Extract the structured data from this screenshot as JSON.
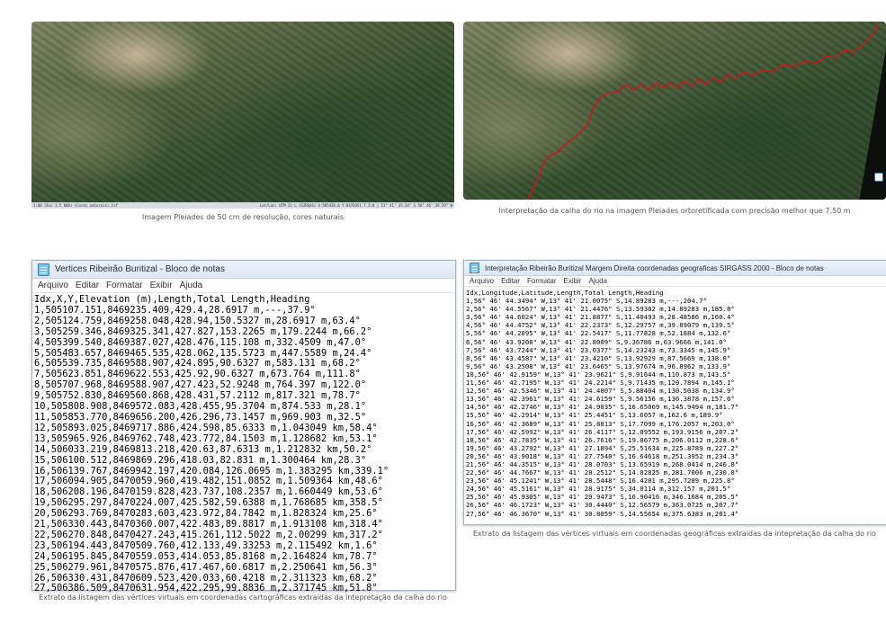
{
  "images": {
    "top_left": {
      "status_left": "1:80 (Esc 1:5 000) (Cores naturais).tif",
      "status_right": "Lat/Lon: UTM 21 L (SIRGAS) X:505436.6 Y:8470351.7 Z:0 | 13° 41' 35.24\" S 56° 46' 39.59\" W",
      "caption": "Imagem Pleiades de 50 cm de resolução, cores naturais"
    },
    "top_right": {
      "caption": "Interpretação da calha do rio na imagem Pleiades ortoretificada com precisão melhor que 7.50 m",
      "river_color": "#c41a1a"
    }
  },
  "notepad_left": {
    "title": "Vertices Ribeirão Buritizal - Bloco de notas",
    "menu": [
      "Arquivo",
      "Editar",
      "Formatar",
      "Exibir",
      "Ajuda"
    ],
    "lines": [
      "Idx,X,Y,Elevation (m),Length,Total Length,Heading",
      "1,505107.151,8469235.409,429.4,28.6917 m,---,37.9°",
      "2,505124.759,8469258.048,428.94,150.5327 m,28.6917 m,63.4°",
      "3,505259.346,8469325.341,427.827,153.2265 m,179.2244 m,66.2°",
      "4,505399.540,8469387.027,428.476,115.108 m,332.4509 m,47.0°",
      "5,505483.657,8469465.535,428.062,135.5723 m,447.5589 m,24.4°",
      "6,505539.735,8469588.907,424.895,90.6327 m,583.131 m,68.2°",
      "7,505623.851,8469622.553,425.92,90.6327 m,673.764 m,111.8°",
      "8,505707.968,8469588.907,427.423,52.9248 m,764.397 m,122.0°",
      "9,505752.830,8469560.868,428.431,57.2112 m,817.321 m,78.7°",
      "10,505808.908,8469572.083,428.455,95.3704 m,874.533 m,28.1°",
      "11,505853.770,8469656.200,426.296,73.1457 m,969.903 m,32.5°",
      "12,505893.025,8469717.886,424.598,85.6333 m,1.043049 km,58.4°",
      "13,505965.926,8469762.748,423.772,84.1503 m,1.128682 km,53.1°",
      "14,506033.219,8469813.218,420.63,87.6313 m,1.212832 km,50.2°",
      "15,506100.512,8469869.296,418.03,82.831 m,1.300464 km,28.3°",
      "16,506139.767,8469942.197,420.084,126.0695 m,1.383295 km,339.1°",
      "17,506094.905,8470059.960,419.482,151.0852 m,1.509364 km,48.6°",
      "18,506208.196,8470159.828,423.737,108.2357 m,1.660449 km,53.6°",
      "19,506295.297,8470224.007,425.582,59.6388 m,1.768685 km,358.5°",
      "20,506293.769,8470283.603,423.972,84.7842 m,1.828324 km,25.6°",
      "21,506330.443,8470360.007,422.483,89.8817 m,1.913108 km,318.4°",
      "22,506270.848,8470427.243,415.261,112.5022 m,2.00299 km,317.2°",
      "23,506194.443,8470509.760,412.133,49.33253 m,2.115492 km,1.6°",
      "24,506195.845,8470559.053,414.053,85.8168 m,2.164824 km,78.7°",
      "25,506279.961,8470575.876,417.467,60.6817 m,2.250641 km,56.3°",
      "26,506330.431,8470609.523,420.033,60.4218 m,2.311323 km,68.2°",
      "27,506386.509,8470631.954,422.295,99.8836 m,2.371745 km,51.8°"
    ],
    "caption": "Extrato da listagem das vértices virtuais em coordenadas cartográficas extraidas da intepretação da calha do rio"
  },
  "notepad_right": {
    "title": "Interpretação Ribeirão Buritizal Margem Direita coordenadas geograficas SIRGASS 2000 - Bloco de notas",
    "menu": [
      "Arquivo",
      "Editar",
      "Formatar",
      "Exibir",
      "Ajuda"
    ],
    "lines": [
      "Idx,Longitude,Latitude,Length,Total Length,Heading",
      "1,56° 46' 44.3494\" W,13° 41' 21.0075\" S,14.89283 m,---,204.7°",
      "2,56° 46' 44.5567\" W,13° 41' 21.4476\" S,13.59302 m,14.89283 m,185.8°",
      "3,56° 46' 44.6024\" W,13° 41' 21.8877\" S,11.40493 m,28.48586 m,160.4°",
      "4,56° 46' 44.4752\" W,13° 41' 22.2373\" S,12.29757 m,39.89079 m,139.5°",
      "5,56° 46' 44.2095\" W,13° 41' 22.5417\" S,11.77828 m,52.1884 m,132.6°",
      "6,56° 46' 43.9208\" W,13° 41' 22.8009\" S,9.36786 m,63.9666 m,141.0°",
      "7,56° 46' 43.7244\" W,13° 41' 23.0377\" S,14.23243 m,73.3345 m,145.9°",
      "8,56° 46' 43.4587\" W,13° 41' 23.4210\" S,13.92929 m,87.5669 m,138.0°",
      "9,56° 46' 43.2508\" W,13° 41' 23.6465\" S,13.97674 m,96.8962 m,133.9°",
      "10,56° 46' 42.9159\" W,13° 41' 23.9621\" S,9.91644 m,110.873 m,143.5°",
      "11,56° 46' 42.7195\" W,13° 41' 24.2214\" S,9.71435 m,120.7894 m,145.1°",
      "12,56° 46' 42.5346\" W,13° 41' 24.4807\" S,5.88404 m,130.5038 m,134.9°",
      "13,56° 46' 42.3961\" W,13° 41' 24.6159\" S,9.56156 m,136.3878 m,157.6°",
      "14,56° 46' 42.2746\" W,13° 41' 24.9035\" S,16.65069 m,145.9494 m,181.7°",
      "15,56° 46' 42.2914\" W,13° 41' 25.4451\" S,13.6057 m,162.6 m,189.9°",
      "16,56° 46' 42.3689\" W,13° 41' 25.8813\" S,17.7099 m,176.2057 m,203.0°",
      "17,56° 46' 42.5992\" W,13° 41' 26.4117\" S,12.09552 m,193.9156 m,207.2°",
      "18,56° 46' 42.7835\" W,13° 41' 26.7616\" S,19.86775 m,206.0112 m,228.6°",
      "19,56° 46' 43.2792\" W,13° 41' 27.1894\" S,25.51634 m,225.8789 m,227.2°",
      "20,56° 46' 43.9018\" W,13° 41' 27.7540\" S,16.64618 m,251.3952 m,234.3°",
      "21,56° 46' 44.3515\" W,13° 41' 28.0703\" S,13.65919 m,268.0414 m,246.0°",
      "22,56° 46' 44.7667\" W,13° 41' 28.2512\" S,14.02825 m,281.7006 m,230.0°",
      "23,56° 46' 45.1241\" W,13° 41' 28.5448\" S,16.4281 m,295.7289 m,225.8°",
      "24,56° 46' 45.5161\" W,13° 41' 28.9175\" S,34.0114 m,312.157 m,201.5°",
      "25,56° 46' 45.9305\" W,13° 41' 29.9473\" S,16.90416 m,346.1684 m,205.5°",
      "26,56° 46' 46.1723\" W,13° 41' 30.4440\" S,12.56579 m,363.0725 m,207.7°",
      "27,56° 46' 46.3670\" W,13° 41' 30.8059\" S,14.55654 m,375.6383 m,201.4°"
    ],
    "caption": "Extrato da listagem das vértices virtuais em coordenadas geográficas extraidas da intepretação da calha do rio"
  }
}
